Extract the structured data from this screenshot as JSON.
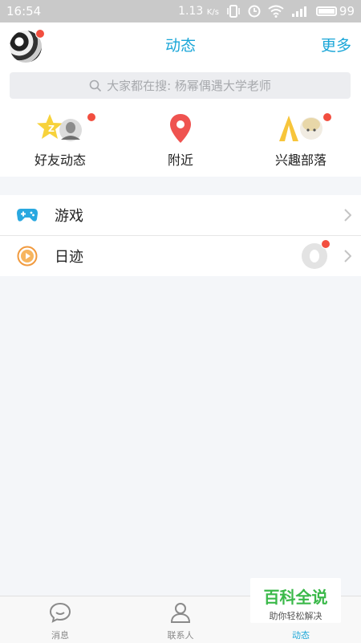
{
  "status": {
    "time": "16:54",
    "speed": "1.13",
    "speed_unit": "K/s",
    "battery": "99"
  },
  "header": {
    "title": "动态",
    "more": "更多"
  },
  "search": {
    "placeholder": "大家都在搜: 杨幂偶遇大学老师"
  },
  "quick": [
    {
      "label": "好友动态",
      "icon": "friend-feed-icon"
    },
    {
      "label": "附近",
      "icon": "location-pin-icon"
    },
    {
      "label": "兴趣部落",
      "icon": "tribe-icon"
    }
  ],
  "list": [
    {
      "label": "游戏",
      "icon": "gamepad-icon"
    },
    {
      "label": "日迹",
      "icon": "video-play-icon"
    }
  ],
  "tabs": [
    {
      "label": "消息",
      "icon": "chat-icon"
    },
    {
      "label": "联系人",
      "icon": "contacts-icon"
    },
    {
      "label": "动态",
      "icon": "star-icon"
    }
  ],
  "watermark": {
    "brand": "百科全说",
    "slogan": "助你轻松解决"
  },
  "colors": {
    "accent": "#1aa6d8",
    "badge": "#f24e3f",
    "pin": "#ef5350",
    "game": "#29a8e0",
    "video": "#f19a3e"
  }
}
